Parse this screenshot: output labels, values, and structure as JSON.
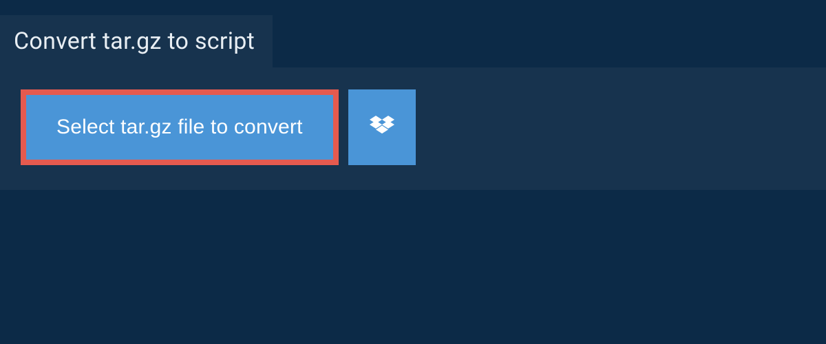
{
  "header": {
    "title": "Convert tar.gz to script"
  },
  "buttons": {
    "select_label": "Select tar.gz file to convert"
  },
  "colors": {
    "page_bg": "#0c2a47",
    "panel_bg": "#17334e",
    "button_bg": "#4a95d7",
    "highlight_border": "#e55a4f",
    "text_light": "#e8eef3",
    "text_white": "#ffffff"
  }
}
